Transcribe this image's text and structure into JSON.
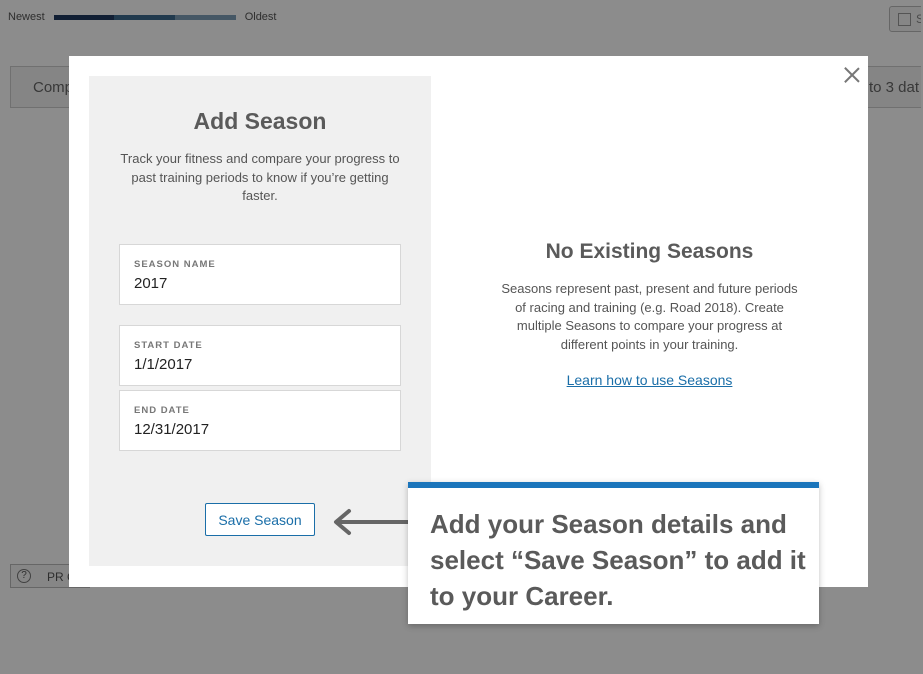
{
  "background": {
    "legend": {
      "newest_label": "Newest",
      "oldest_label": "Oldest",
      "segment_colors": [
        "#1f3a5f",
        "#3d6a8e",
        "#7f9fb9"
      ]
    },
    "checkbox_button_text": "S",
    "compare_label": "Comp",
    "compare_right_text": "to 3 dat",
    "help_glyph": "?",
    "pr_label": "PR C"
  },
  "modal": {
    "form": {
      "title": "Add Season",
      "description": "Track your fitness and compare your progress to past training periods to know if you’re getting faster.",
      "fields": [
        {
          "label": "SEASON NAME",
          "value": "2017"
        },
        {
          "label": "START DATE",
          "value": "1/1/2017"
        },
        {
          "label": "END DATE",
          "value": "12/31/2017"
        }
      ],
      "save_label": "Save Season"
    },
    "empty_state": {
      "title": "No Existing Seasons",
      "description": "Seasons represent past, present and future periods of racing and training (e.g. Road 2018). Create multiple Seasons to compare your progress at different points in your training.",
      "link_label": "Learn how to use Seasons"
    }
  },
  "callout": {
    "text": "Add your Season details and select “Save Season” to add it to your Career.",
    "accent_color": "#1b75bb"
  },
  "colors": {
    "link": "#1a6ea8",
    "overlay": "rgba(0,0,0,0.45)"
  }
}
